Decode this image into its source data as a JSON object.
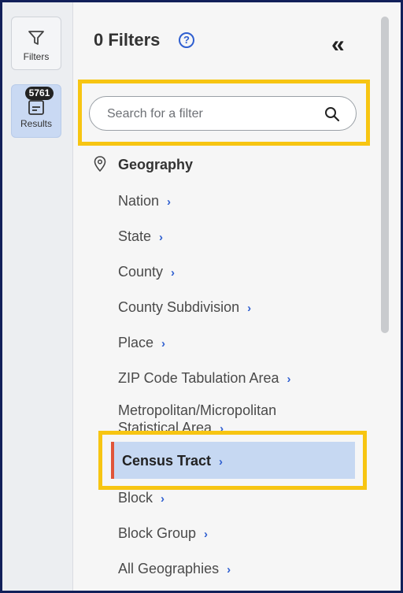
{
  "rail": {
    "filters_label": "Filters",
    "results_label": "Results",
    "results_count": "5761"
  },
  "panel": {
    "title": "0 Filters",
    "help_symbol": "?",
    "collapse_symbol": "«"
  },
  "search": {
    "placeholder": "Search for a filter",
    "value": ""
  },
  "geography": {
    "heading": "Geography",
    "items": [
      {
        "label": "Nation"
      },
      {
        "label": "State"
      },
      {
        "label": "County"
      },
      {
        "label": "County Subdivision"
      },
      {
        "label": "Place"
      },
      {
        "label": "ZIP Code Tabulation Area"
      },
      {
        "label_line1": "Metropolitan/Micropolitan",
        "label_line2": "Statistical Area"
      },
      {
        "label": "Census Tract",
        "selected": true
      },
      {
        "label": "Block"
      },
      {
        "label": "Block Group"
      },
      {
        "label": "All Geographies"
      }
    ],
    "chevron": "›"
  },
  "colors": {
    "frame_border": "#12205a",
    "highlight": "#f7c512",
    "selected_bg": "#c6d8f2",
    "selected_accent": "#e0553a",
    "link_blue": "#2f5fd0"
  }
}
